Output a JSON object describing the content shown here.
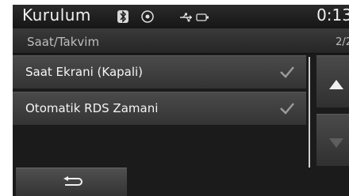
{
  "statusbar": {
    "app_title": "Kurulum",
    "clock": "0:13",
    "icons": [
      "bluetooth-icon",
      "target-icon",
      "usb-icon"
    ]
  },
  "header": {
    "title": "Saat/Takvim",
    "page_indicator": "2/2"
  },
  "settings": [
    {
      "label": "Saat Ekrani (Kapali)",
      "checked": true
    },
    {
      "label": "Otomatik RDS Zamani",
      "checked": true
    }
  ],
  "controls": {
    "scroll_up_icon": "triangle-up-icon",
    "scroll_down_icon": "triangle-down-icon",
    "back_icon": "return-arrow-icon"
  },
  "colors": {
    "background": "#1b1b1b",
    "item": "#404040",
    "text": "#f5f5f5",
    "check": "#9a9a9a"
  }
}
